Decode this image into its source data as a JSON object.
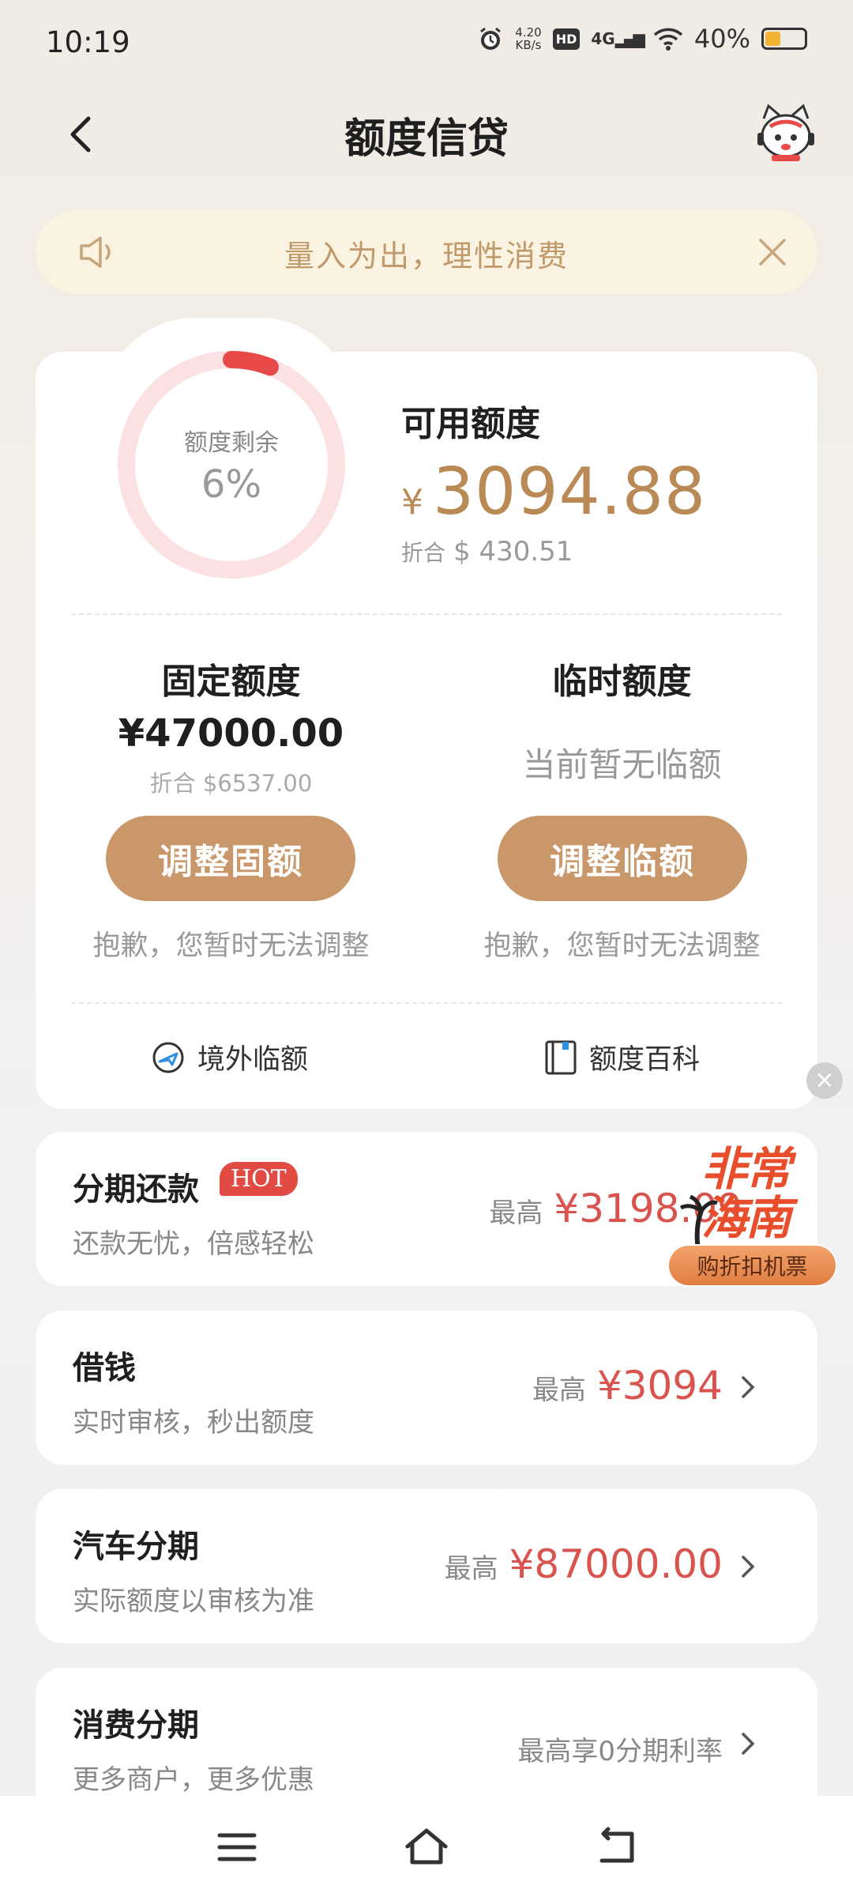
{
  "status_bar": {
    "time": "10:19",
    "net_speed_value": "4.20",
    "net_speed_unit": "KB/s",
    "hd_badge": "HD",
    "network": "4G",
    "battery_text": "40%",
    "battery_level": 0.4,
    "battery_color": "#f2b233"
  },
  "header": {
    "title": "额度信贷",
    "back_icon": "chevron-left-icon",
    "mascot_icon": "cat-mascot-icon"
  },
  "notice": {
    "text": "量入为出，理性消费",
    "icon": "speaker-icon",
    "close_icon": "close-icon"
  },
  "credit": {
    "ring_label": "额度剩余",
    "ring_percent_text": "6%",
    "ring_fraction": 0.06,
    "available_label": "可用额度",
    "available_currency": "¥",
    "available_amount": "3094.88",
    "converted_prefix": "折合",
    "converted_amount": "$ 430.51",
    "fixed": {
      "title": "固定额度",
      "amount": "¥47000.00",
      "converted": "折合 $6537.00",
      "button": "调整固额",
      "note": "抱歉，您暂时无法调整"
    },
    "temp": {
      "title": "临时额度",
      "status": "当前暂无临额",
      "button": "调整临额",
      "note": "抱歉，您暂时无法调整"
    },
    "links": [
      {
        "label": "境外临额",
        "icon": "plane-globe-icon"
      },
      {
        "label": "额度百科",
        "icon": "book-icon"
      }
    ]
  },
  "services": [
    {
      "title": "分期还款",
      "badge": "HOT",
      "subtitle": "还款无忧，倍感轻松",
      "prefix": "最高",
      "amount": "¥3198.09"
    },
    {
      "title": "借钱",
      "subtitle": "实时审核，秒出额度",
      "prefix": "最高",
      "amount": "¥3094"
    },
    {
      "title": "汽车分期",
      "subtitle": "实际额度以审核为准",
      "prefix": "最高",
      "amount": "¥87000.00"
    },
    {
      "title": "消费分期",
      "subtitle": "更多商户，更多优惠",
      "prefix": "最高享0分期利率",
      "amount": ""
    }
  ],
  "promo": {
    "line1": "非常",
    "line2": "海南",
    "button": "购折扣机票",
    "close": "×"
  },
  "nav": {
    "menu_icon": "menu-icon",
    "home_icon": "home-icon",
    "back_icon": "back-icon"
  },
  "colors": {
    "accent": "#c9976a",
    "gold_text": "#b98a55",
    "red_amount": "#d9534f",
    "ring_track": "#fbe1e1",
    "ring_fill": "#e84a4a"
  }
}
